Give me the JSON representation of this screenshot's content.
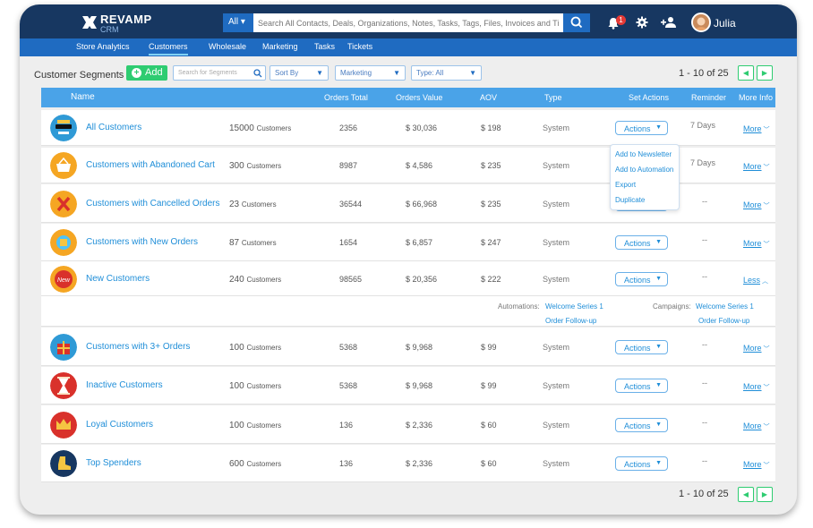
{
  "app": {
    "brand": "REVAMP",
    "brand_sub": "CRM",
    "user_name": "Julia",
    "notification_count": "1"
  },
  "search": {
    "scope": "All",
    "placeholder": "Search All Contacts, Deals, Organizations, Notes, Tasks, Tags, Files, Invoices and Tickets"
  },
  "nav": [
    "Store Analytics",
    "Customers",
    "Wholesale",
    "Marketing",
    "Tasks",
    "Tickets"
  ],
  "nav_active": "Customers",
  "toolbar": {
    "title": "Customer Segments",
    "add_label": "Add",
    "search_placeholder": "Search for Segments",
    "sort_label": "Sort By",
    "category_label": "Marketing",
    "type_label": "Type: All"
  },
  "pagination": {
    "range": "1 - 10",
    "of": "of 25",
    "prev": "◀",
    "next": "▶"
  },
  "table": {
    "columns": [
      "Name",
      "Orders Total",
      "Orders Value",
      "AOV",
      "Type",
      "Set Actions",
      "Reminder",
      "More Info"
    ],
    "customers_word": "Customers",
    "actions_label": "Actions",
    "rows": [
      {
        "name": "All Customers",
        "count": "15000",
        "orders_total": "2356",
        "orders_value": "$ 30,036",
        "aov": "$ 198",
        "type": "System",
        "reminder": "7 Days",
        "more": "More",
        "icon": "sunglasses-face-icon",
        "icon_color": "#2f9ad6"
      },
      {
        "name": "Customers with Abandoned Cart",
        "count": "300",
        "orders_total": "8987",
        "orders_value": "$ 4,586",
        "aov": "$ 235",
        "type": "System",
        "reminder": "7 Days",
        "more": "More",
        "icon": "basket-icon",
        "icon_color": "#f5a623"
      },
      {
        "name": "Customers with Cancelled Orders",
        "count": "23",
        "orders_total": "36544",
        "orders_value": "$ 66,968",
        "aov": "$ 235",
        "type": "System",
        "reminder": "--",
        "more": "More",
        "icon": "cancel-x-icon",
        "icon_color": "#f5a623"
      },
      {
        "name": "Customers with New Orders",
        "count": "87",
        "orders_total": "1654",
        "orders_value": "$ 6,857",
        "aov": "$ 247",
        "type": "System",
        "reminder": "--",
        "more": "More",
        "icon": "new-order-icon",
        "icon_color": "#f5a623"
      },
      {
        "name": "New Customers",
        "count": "240",
        "orders_total": "98565",
        "orders_value": "$ 20,356",
        "aov": "$ 222",
        "type": "System",
        "reminder": "--",
        "more": "Less",
        "icon": "new-badge-icon",
        "icon_color": "#f5a623"
      },
      {
        "name": "Customers with 3+ Orders",
        "count": "100",
        "orders_total": "5368",
        "orders_value": "$ 9,968",
        "aov": "$ 99",
        "type": "System",
        "reminder": "--",
        "more": "More",
        "icon": "gift-icon",
        "icon_color": "#2f9ad6"
      },
      {
        "name": "Inactive Customers",
        "count": "100",
        "orders_total": "5368",
        "orders_value": "$ 9,968",
        "aov": "$ 99",
        "type": "System",
        "reminder": "--",
        "more": "More",
        "icon": "hourglass-icon",
        "icon_color": "#d9312b"
      },
      {
        "name": "Loyal Customers",
        "count": "100",
        "orders_total": "136",
        "orders_value": "$ 2,336",
        "aov": "$ 60",
        "type": "System",
        "reminder": "--",
        "more": "More",
        "icon": "crown-icon",
        "icon_color": "#d9312b"
      },
      {
        "name": "Top Spenders",
        "count": "600",
        "orders_total": "136",
        "orders_value": "$ 2,336",
        "aov": "$ 60",
        "type": "System",
        "reminder": "--",
        "more": "More",
        "icon": "boot-icon",
        "icon_color": "#173761"
      }
    ]
  },
  "expanded": {
    "automations_label": "Automations:",
    "automations": [
      "Welcome Series 1",
      "Order Follow-up"
    ],
    "campaigns_label": "Campaigns:",
    "campaigns": [
      "Welcome Series 1",
      "Order Follow-up"
    ]
  },
  "actions_menu": [
    "Add to Newsletter",
    "Add to Automation",
    "Export",
    "Duplicate"
  ]
}
